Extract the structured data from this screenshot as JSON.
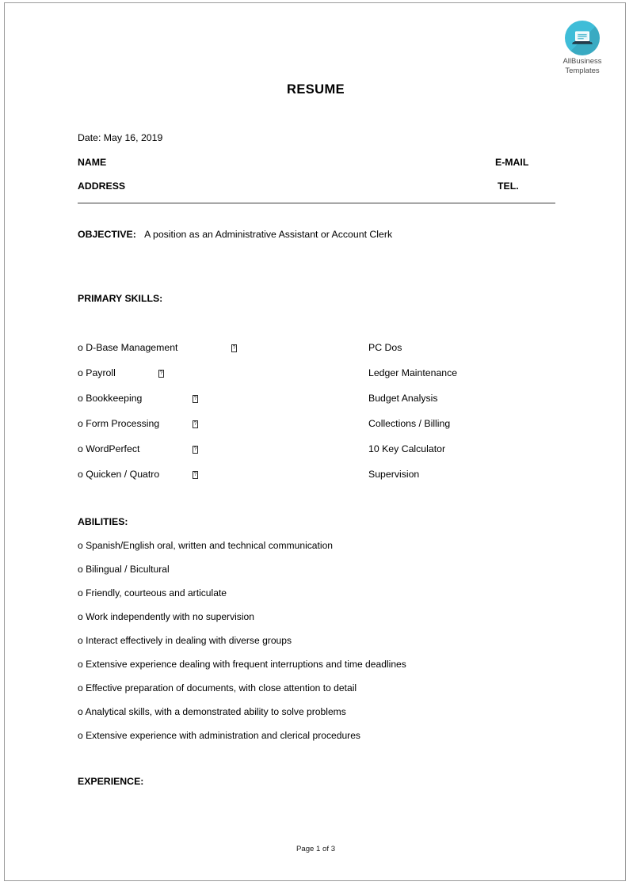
{
  "logo": {
    "icon": "laptop-icon",
    "circle_color": "#3fbdd8",
    "caption_line1": "AllBusiness",
    "caption_line2": "Templates"
  },
  "document": {
    "title": "RESUME",
    "date_line": "Date: May 16, 2019",
    "name_label": "NAME",
    "email_label": "E-MAIL",
    "address_label": "ADDRESS",
    "tel_label": "TEL.",
    "objective_label": "OBJECTIVE:",
    "objective_text": "A position as an Administrative Assistant or Account Clerk",
    "primary_skills_heading": "PRIMARY SKILLS:",
    "abilities_heading": "ABILITIES:",
    "experience_heading": "EXPERIENCE:",
    "bullet": "o",
    "missing_glyph": "?",
    "skills": [
      {
        "left": "D-Base Management",
        "right": "PC Dos"
      },
      {
        "left": "Payroll",
        "right": "Ledger Maintenance"
      },
      {
        "left": "Bookkeeping",
        "right": "Budget Analysis"
      },
      {
        "left": "Form Processing",
        "right": "Collections / Billing"
      },
      {
        "left": "WordPerfect",
        "right": "10 Key Calculator"
      },
      {
        "left": "Quicken / Quatro",
        "right": "Supervision"
      }
    ],
    "abilities": [
      "Spanish/English oral, written and technical communication",
      "Bilingual / Bicultural",
      "Friendly, courteous and articulate",
      "Work independently with no supervision",
      "Interact effectively in dealing with diverse groups",
      "Extensive experience dealing with frequent interruptions and time deadlines",
      "Effective preparation of documents, with close attention to detail",
      "Analytical skills, with a demonstrated ability to solve problems",
      "Extensive experience with administration and clerical procedures"
    ],
    "footer": "Page 1 of 3"
  }
}
